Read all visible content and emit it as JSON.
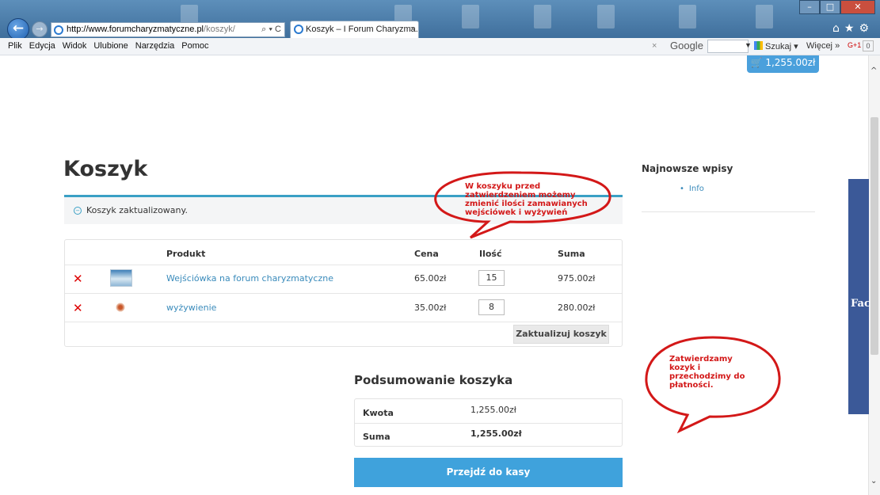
{
  "browser": {
    "address_domain": "http://www.forumcharyzmatyczne.pl",
    "address_path": "/koszyk/",
    "address_tools": "⌕ ▾ C",
    "tab_title": "Koszyk – I Forum Charyzma...",
    "tab_close": "×",
    "menu": [
      "Plik",
      "Edycja",
      "Widok",
      "Ulubione",
      "Narzędzia",
      "Pomoc"
    ],
    "google_close": "×",
    "google_label": "Google",
    "google_search": "Szukaj",
    "google_more": "Więcej",
    "google_plus": "G+1",
    "google_count": "0"
  },
  "header": {
    "cart_total": "1,255.00zł"
  },
  "page": {
    "title": "Koszyk",
    "notice": "Koszyk zaktualizowany."
  },
  "cart": {
    "columns": {
      "product": "Produkt",
      "price": "Cena",
      "qty": "Ilość",
      "total": "Suma"
    },
    "items": [
      {
        "name": "Wejściówka na forum charyzmatyczne",
        "price": "65.00zł",
        "qty": "15",
        "total": "975.00zł"
      },
      {
        "name": "wyżywienie",
        "price": "35.00zł",
        "qty": "8",
        "total": "280.00zł"
      }
    ],
    "update_label": "Zaktualizuj koszyk"
  },
  "sidebar": {
    "title": "Najnowsze wpisy",
    "links": [
      "Info"
    ]
  },
  "facebook_tab": "Fac",
  "summary": {
    "title": "Podsumowanie koszyka",
    "rows": [
      {
        "label": "Kwota",
        "value": "1,255.00zł"
      },
      {
        "label": "Suma",
        "value": "1,255.00zł"
      }
    ],
    "checkout_label": "Przejdź do kasy"
  },
  "annotations": {
    "top": [
      "W koszyku przed",
      "zatwierdzeniem możemy",
      "zmienić ilości zamawianych",
      "wejściówek i wyżywień"
    ],
    "right": [
      "Zatwierdzamy",
      "kozyk i",
      "przechodzimy do",
      "płatności."
    ],
    "color": "#d31818"
  },
  "colors": {
    "accent": "#3aa0c5",
    "link": "#3a8bbb",
    "button": "#3fa2dc",
    "remove": "#dd0000"
  }
}
